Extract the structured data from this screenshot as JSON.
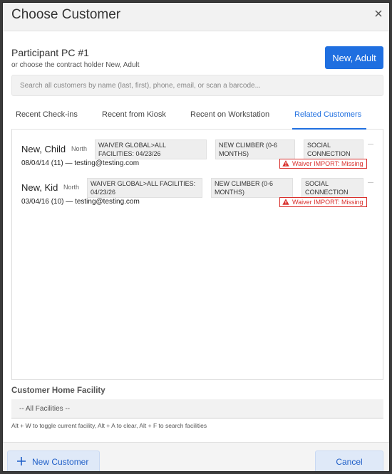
{
  "header": {
    "title": "Choose Customer",
    "close_icon": "close-icon"
  },
  "participant": {
    "title": "Participant PC #1",
    "subtitle": "or choose the contract holder New, Adult",
    "button_label": "New, Adult"
  },
  "search": {
    "placeholder": "Search all customers by name (last, first), phone, email, or scan a barcode..."
  },
  "tabs": [
    {
      "label": "Recent Check-ins",
      "active": false
    },
    {
      "label": "Recent from Kiosk",
      "active": false
    },
    {
      "label": "Recent on Workstation",
      "active": false
    },
    {
      "label": "Related Customers",
      "active": true
    }
  ],
  "customers": [
    {
      "name": "New, Child",
      "facility": "North",
      "tags": [
        "WAIVER GLOBAL>ALL FACILITIES: 04/23/26",
        "NEW CLIMBER (0-6 MONTHS)",
        "SOCIAL CONNECTION"
      ],
      "dob_age": "08/04/14 (11)",
      "separator": "—",
      "email": "testing@testing.com",
      "waiver_alert": "Waiver IMPORT: Missing"
    },
    {
      "name": "New, Kid",
      "facility": "North",
      "tags": [
        "WAIVER GLOBAL>ALL FACILITIES: 04/23/26",
        "NEW CLIMBER (0-6 MONTHS)",
        "SOCIAL CONNECTION"
      ],
      "dob_age": "03/04/16 (10)",
      "separator": "—",
      "email": "testing@testing.com",
      "waiver_alert": "Waiver IMPORT: Missing"
    }
  ],
  "facility": {
    "label": "Customer Home Facility",
    "selected": "-- All Facilities --",
    "hint": "Alt + W to toggle current facility, Alt + A to clear, Alt + F to search facilities"
  },
  "footer": {
    "new_customer_label": "New Customer",
    "cancel_label": "Cancel"
  },
  "colors": {
    "accent": "#1f6fe0",
    "alert": "#d9302c",
    "header_bg": "#f2f2f2"
  }
}
